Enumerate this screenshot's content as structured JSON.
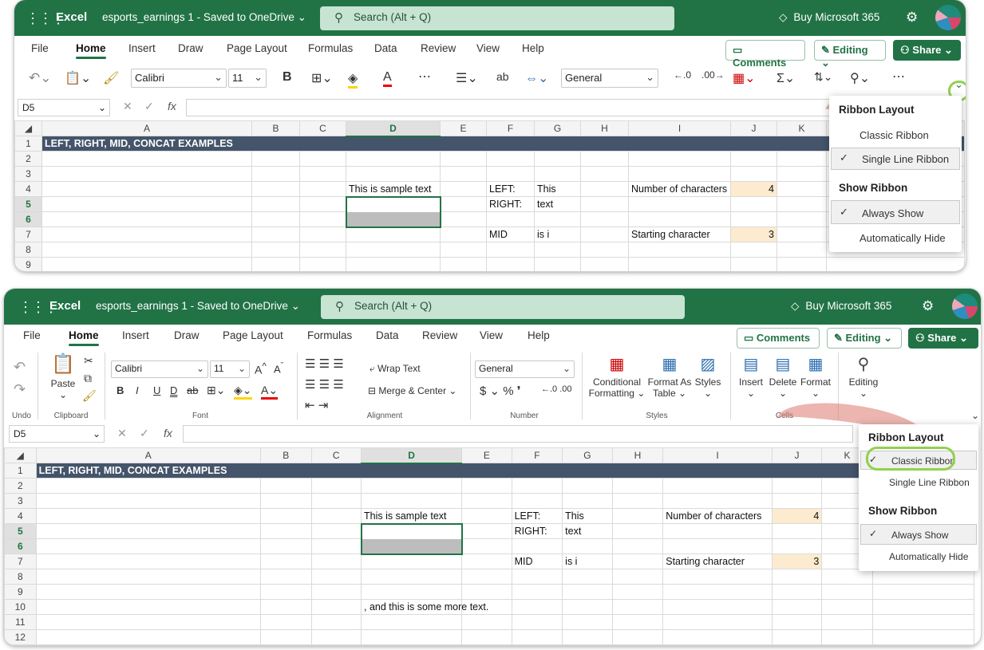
{
  "top": {
    "app": "Excel",
    "doc": "esports_earnings 1  -  Saved to OneDrive",
    "search": "Search (Alt + Q)",
    "buy": "Buy Microsoft 365",
    "tabs": [
      "File",
      "Home",
      "Insert",
      "Draw",
      "Page Layout",
      "Formulas",
      "Data",
      "Review",
      "View",
      "Help"
    ],
    "comments": "Comments",
    "editing": "Editing",
    "share": "Share",
    "font": "Calibri",
    "size": "11",
    "format": "General",
    "namebox": "D5",
    "fx": "fx",
    "cols": [
      "",
      "A",
      "B",
      "C",
      "D",
      "E",
      "F",
      "G",
      "H",
      "I",
      "J",
      "K"
    ],
    "rows": [
      "1",
      "2",
      "3",
      "4",
      "5",
      "6",
      "7",
      "8",
      "9"
    ],
    "banner": "LEFT, RIGHT, MID, CONCAT EXAMPLES",
    "d4": "This is sample text",
    "f4": "LEFT:",
    "g4": "This",
    "i4": "Number of characters",
    "j4": "4",
    "f5": "RIGHT:",
    "g5": "text",
    "f7": "MID",
    "g7": "is i",
    "i7": "Starting character",
    "j7": "3",
    "menu": {
      "h1": "Ribbon Layout",
      "classic": "Classic Ribbon",
      "single": "Single Line Ribbon",
      "h2": "Show Ribbon",
      "always": "Always Show",
      "auto": "Automatically Hide"
    }
  },
  "bottom": {
    "app": "Excel",
    "doc": "esports_earnings 1  -  Saved to OneDrive",
    "search": "Search (Alt + Q)",
    "buy": "Buy Microsoft 365",
    "tabs": [
      "File",
      "Home",
      "Insert",
      "Draw",
      "Page Layout",
      "Formulas",
      "Data",
      "Review",
      "View",
      "Help"
    ],
    "comments": "Comments",
    "editing": "Editing",
    "share": "Share",
    "ribbon": {
      "undo": "Undo",
      "paste": "Paste",
      "clipboard": "Clipboard",
      "font": "Calibri",
      "size": "11",
      "font_group": "Font",
      "wrap": "Wrap Text",
      "merge": "Merge & Center",
      "alignment": "Alignment",
      "format": "General",
      "number": "Number",
      "cond": "Conditional Formatting",
      "fmt_table": "Format As Table",
      "styles_btn": "Styles",
      "styles": "Styles",
      "insert": "Insert",
      "delete": "Delete",
      "format_btn": "Format",
      "cells": "Cells",
      "editing": "Editing"
    },
    "namebox": "D5",
    "fx": "fx",
    "cols": [
      "",
      "A",
      "B",
      "C",
      "D",
      "E",
      "F",
      "G",
      "H",
      "I",
      "J",
      "K"
    ],
    "rows": [
      "1",
      "2",
      "3",
      "4",
      "5",
      "6",
      "7",
      "8",
      "9",
      "10",
      "11",
      "12"
    ],
    "banner": "LEFT, RIGHT, MID, CONCAT EXAMPLES",
    "d4": "This is sample text",
    "f4": "LEFT:",
    "g4": "This",
    "i4": "Number of characters",
    "j4": "4",
    "f5": "RIGHT:",
    "g5": "text",
    "f7": "MID",
    "g7": "is i",
    "i7": "Starting character",
    "j7": "3",
    "d10": ", and this is some more text.",
    "menu": {
      "h1": "Ribbon Layout",
      "classic": "Classic Ribbon",
      "single": "Single Line Ribbon",
      "h2": "Show Ribbon",
      "always": "Always Show",
      "auto": "Automatically Hide"
    }
  }
}
